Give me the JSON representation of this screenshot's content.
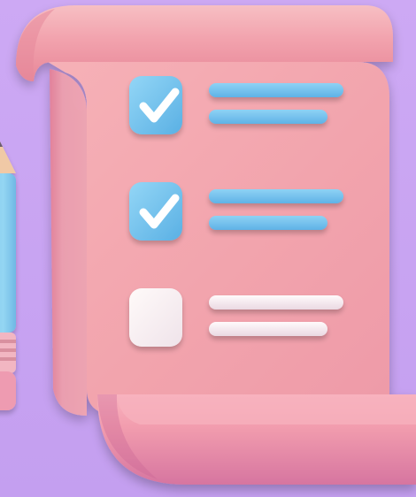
{
  "scene": {
    "description_colors": {
      "background": "#c9a6f2",
      "paper": "#f3a5ae",
      "paper_shadow": "#e07f92",
      "checkbox_blue": "#7cc6ec",
      "checkbox_white": "#f7f2f6",
      "line_blue": "#74c0ec",
      "line_white": "#f7eff3",
      "pencil_body": "#8ccfee",
      "pencil_band": "#f0b6c5"
    }
  },
  "checklist": {
    "items": [
      {
        "checked": true
      },
      {
        "checked": true
      },
      {
        "checked": false
      }
    ]
  }
}
